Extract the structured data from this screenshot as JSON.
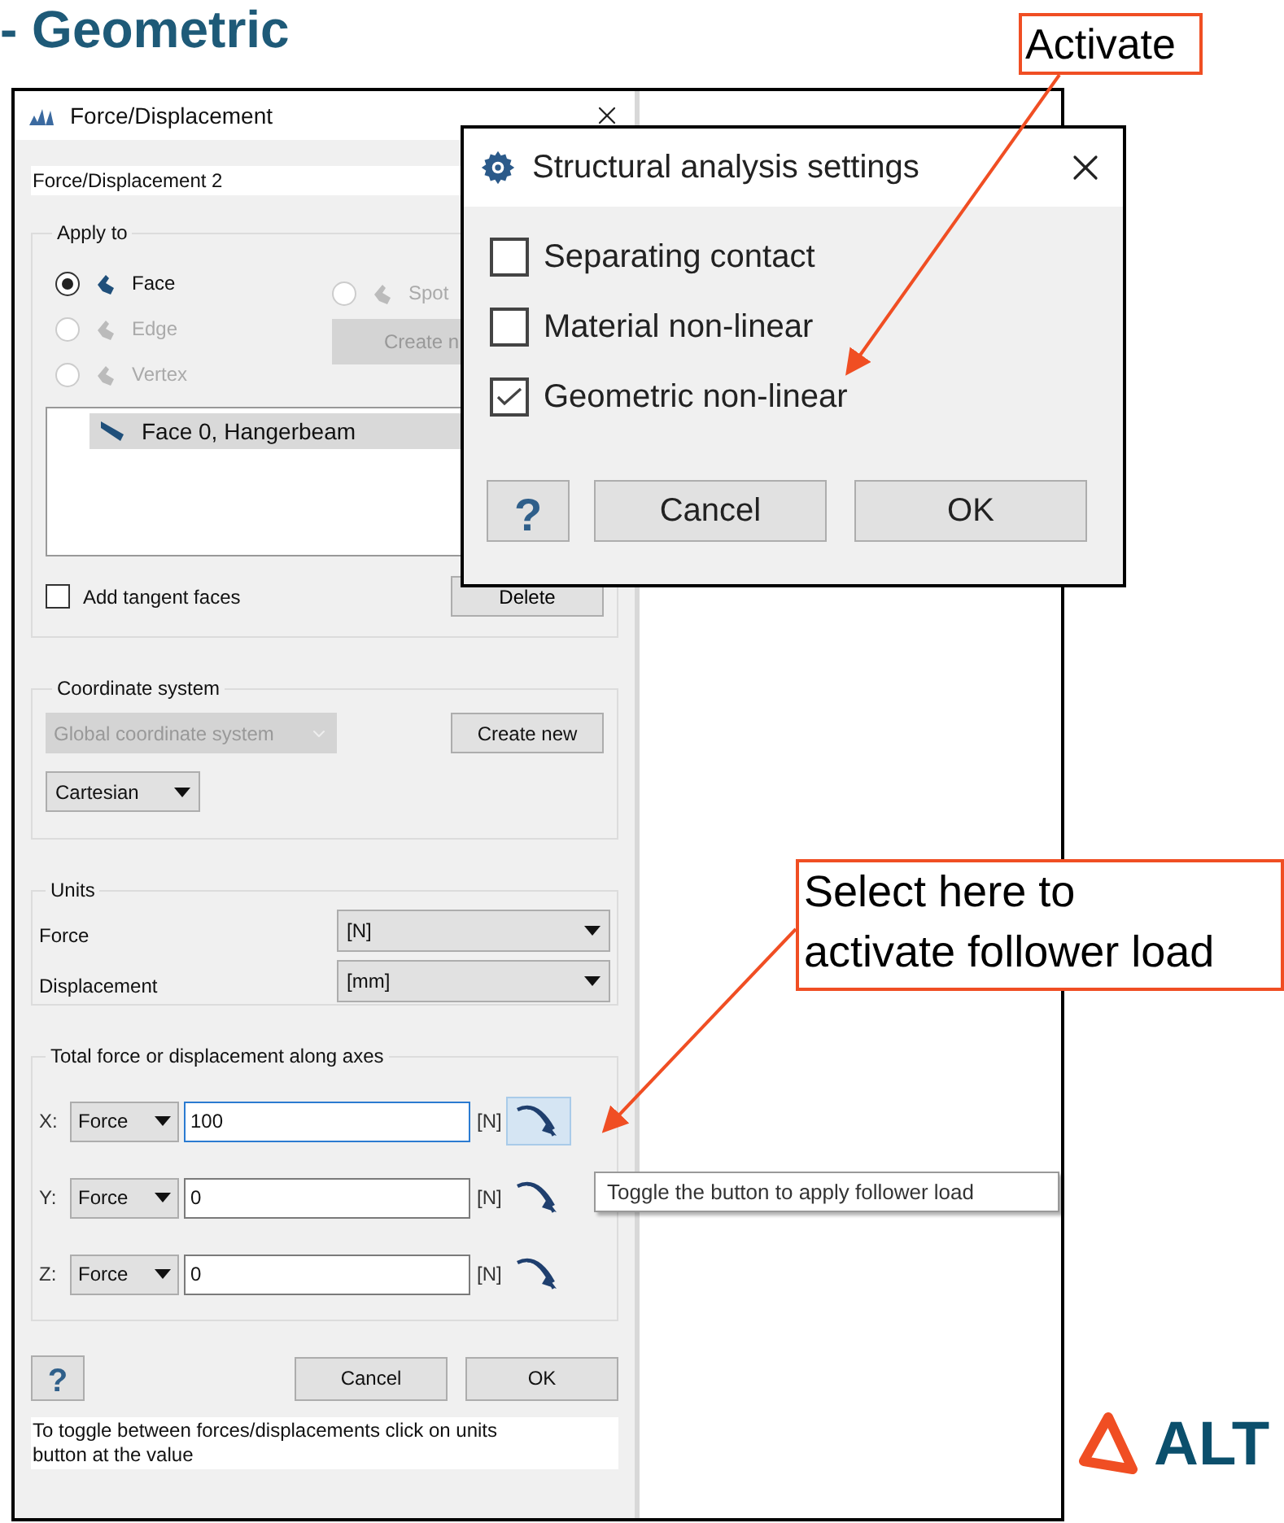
{
  "slide_title": "- Geometric",
  "force_dialog": {
    "title": "Force/Displacement",
    "name": "Force/Displacement 2",
    "apply_to": {
      "label": "Apply to",
      "options": [
        {
          "label": "Face",
          "selected": true,
          "disabled": false
        },
        {
          "label": "Edge",
          "selected": false,
          "disabled": true
        },
        {
          "label": "Vertex",
          "selected": false,
          "disabled": true
        },
        {
          "label": "Spot",
          "selected": false,
          "disabled": true
        }
      ],
      "create_button": "Create n",
      "list_items": [
        {
          "label": "Face 0, Hangerbeam",
          "selected": true
        }
      ],
      "add_tangent_faces": {
        "label": "Add tangent faces",
        "checked": false
      },
      "delete_button": "Delete"
    },
    "coordinate_system": {
      "label": "Coordinate system",
      "system": "Global coordinate system",
      "system_disabled": true,
      "create_button": "Create new",
      "type": "Cartesian"
    },
    "units": {
      "label": "Units",
      "rows": [
        {
          "label": "Force",
          "value": "[N]"
        },
        {
          "label": "Displacement",
          "value": "[mm]"
        }
      ]
    },
    "axes": {
      "label": "Total force or displacement along axes",
      "rows": [
        {
          "axis": "X:",
          "type": "Force",
          "value": "100",
          "unit": "[N]",
          "follower_selected": true
        },
        {
          "axis": "Y:",
          "type": "Force",
          "value": "0",
          "unit": "[N]",
          "follower_selected": false
        },
        {
          "axis": "Z:",
          "type": "Force",
          "value": "0",
          "unit": "[N]",
          "follower_selected": false
        }
      ],
      "tooltip": "Toggle the button to apply follower load"
    },
    "buttons": {
      "help": "?",
      "cancel": "Cancel",
      "ok": "OK"
    },
    "hint": "To toggle between forces/displacements click on units button at the value"
  },
  "settings_dialog": {
    "title": "Structural analysis settings",
    "options": [
      {
        "label": "Separating contact",
        "checked": false
      },
      {
        "label": "Material non-linear",
        "checked": false
      },
      {
        "label": "Geometric non-linear",
        "checked": true
      }
    ],
    "buttons": {
      "help": "?",
      "cancel": "Cancel",
      "ok": "OK"
    }
  },
  "annotations": [
    {
      "lines": [
        "Activate"
      ]
    },
    {
      "lines": [
        "Select here to",
        "activate follower load"
      ]
    }
  ],
  "logo": "ALT"
}
